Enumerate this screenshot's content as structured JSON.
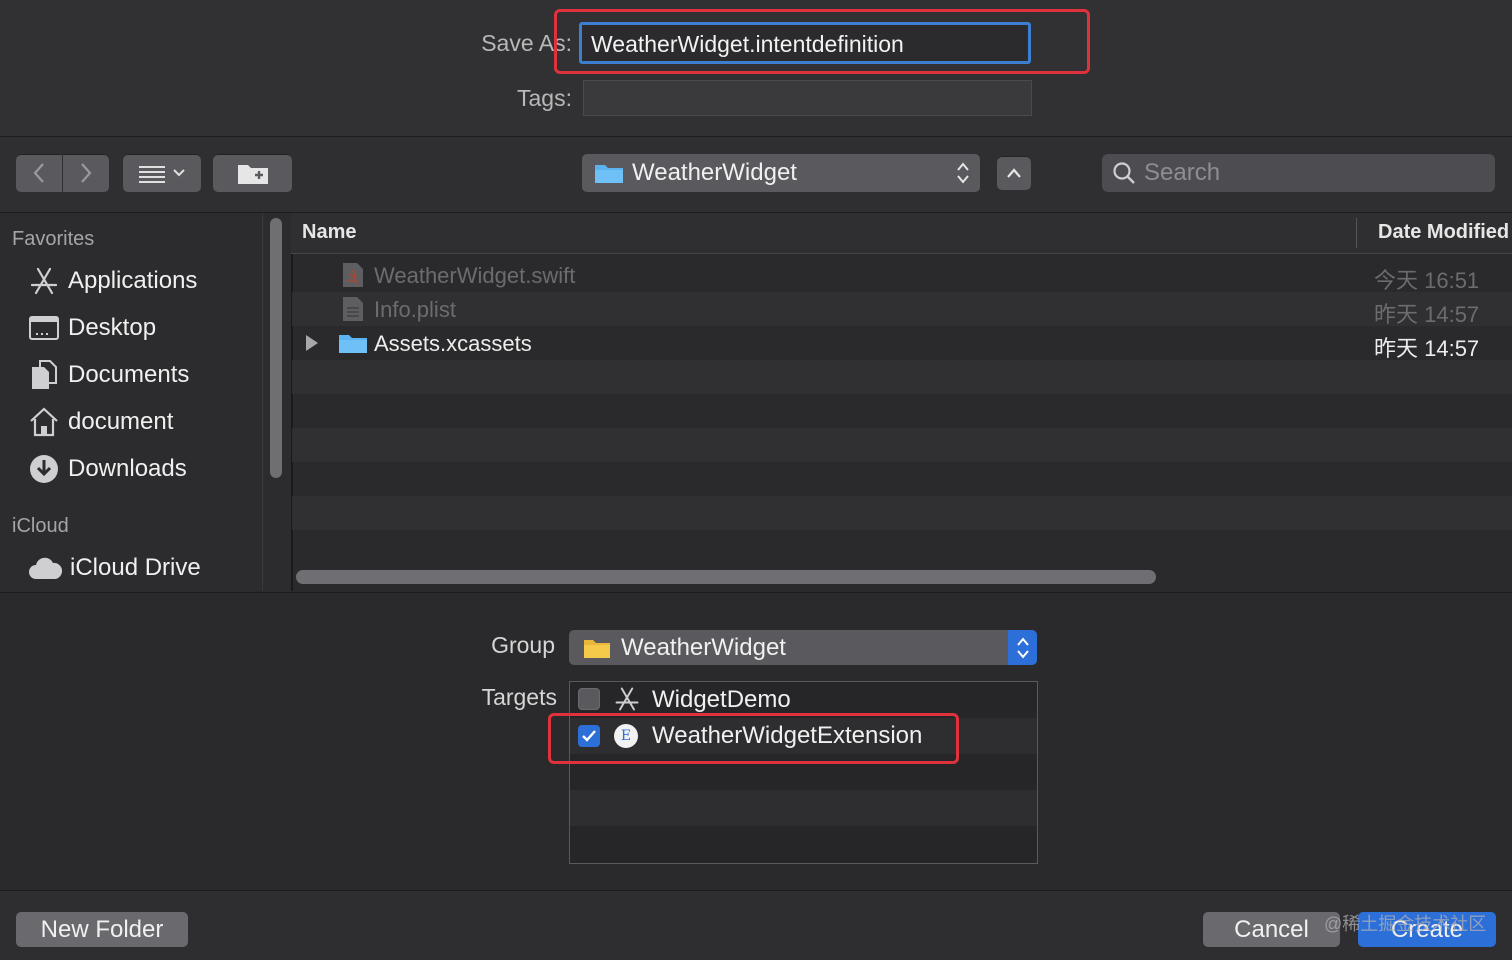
{
  "save_panel": {
    "save_as_label": "Save As:",
    "save_as_value": "WeatherWidget.intentdefinition",
    "tags_label": "Tags:",
    "tags_value": ""
  },
  "toolbar": {
    "location": "WeatherWidget",
    "search_placeholder": "Search"
  },
  "sidebar": {
    "favorites_header": "Favorites",
    "favorites": [
      {
        "label": "Applications",
        "icon": "applications-icon"
      },
      {
        "label": "Desktop",
        "icon": "desktop-icon"
      },
      {
        "label": "Documents",
        "icon": "documents-icon"
      },
      {
        "label": "document",
        "icon": "home-icon"
      },
      {
        "label": "Downloads",
        "icon": "downloads-icon"
      }
    ],
    "icloud_header": "iCloud",
    "icloud": [
      {
        "label": "iCloud Drive",
        "icon": "cloud-icon"
      }
    ]
  },
  "file_list": {
    "columns": [
      "Name",
      "Date Modified"
    ],
    "rows": [
      {
        "name": "WeatherWidget.swift",
        "date": "今天 16:51",
        "icon": "swift-file-icon",
        "enabled": false
      },
      {
        "name": "Info.plist",
        "date": "昨天 14:57",
        "icon": "plist-file-icon",
        "enabled": false
      },
      {
        "name": "Assets.xcassets",
        "date": "昨天 14:57",
        "icon": "folder-icon",
        "enabled": true,
        "expandable": true
      }
    ]
  },
  "options": {
    "group_label": "Group",
    "group_value": "WeatherWidget",
    "targets_label": "Targets",
    "targets": [
      {
        "label": "WidgetDemo",
        "checked": false,
        "icon": "app-target-icon"
      },
      {
        "label": "WeatherWidgetExtension",
        "checked": true,
        "icon": "extension-target-icon",
        "icon_letter": "E"
      }
    ]
  },
  "footer": {
    "new_folder": "New Folder",
    "cancel": "Cancel",
    "create": "Create",
    "watermark": "@稀土掘金技术社区"
  },
  "colors": {
    "accent": "#2d6fd8",
    "highlight_annotation": "#e0323c",
    "background": "#2a2a2c"
  }
}
